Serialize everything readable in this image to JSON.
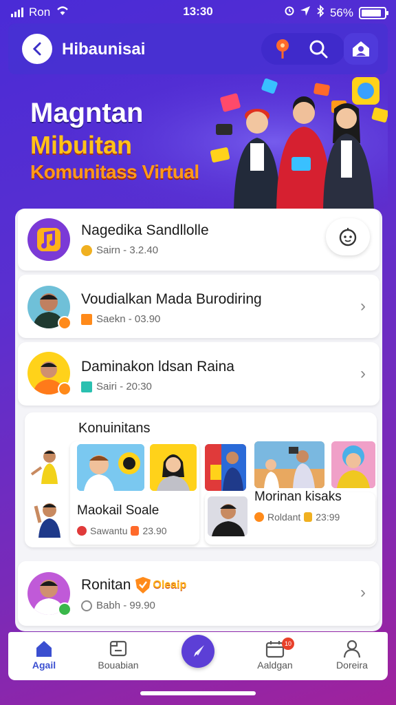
{
  "status": {
    "carrier": "Ron",
    "time": "13:30",
    "battery": "56%",
    "battery_level": 0.86
  },
  "header": {
    "title": "Hibaunisai"
  },
  "banner": {
    "line1": "Magntan",
    "line2": "Mibuitan",
    "line3": "Komunitass Virtual"
  },
  "list": {
    "items": [
      {
        "title": "Nagedika Sandllolle",
        "sub": "Sairn - 3.2.40"
      },
      {
        "title": "Voudialkan Mada  Burodiring",
        "sub": "Saekn - 03.90"
      },
      {
        "title": "Daminakon ldsan Raina",
        "sub": "Sairi - 20:30"
      }
    ],
    "community": {
      "title": "Konuinitans",
      "cards": [
        {
          "title": "Maokail Soale",
          "sub": "Sawantu",
          "count": "23.90"
        },
        {
          "title": "Morinan kisaks",
          "sub": "Roldant",
          "count": "23:99"
        }
      ]
    },
    "last_item": {
      "title": "Ronitan",
      "tag": "Oleaip",
      "sub": "Babh - 99.90"
    }
  },
  "nav": {
    "items": [
      {
        "label": "Agail"
      },
      {
        "label": "Bouabian"
      },
      {
        "label": "Aaldgan"
      },
      {
        "label": "Doreira"
      }
    ],
    "notif_count": "10"
  },
  "colors": {
    "accent": "#3b4fd0",
    "purple": "#5c3fd6",
    "orange": "#ff9a1a"
  }
}
